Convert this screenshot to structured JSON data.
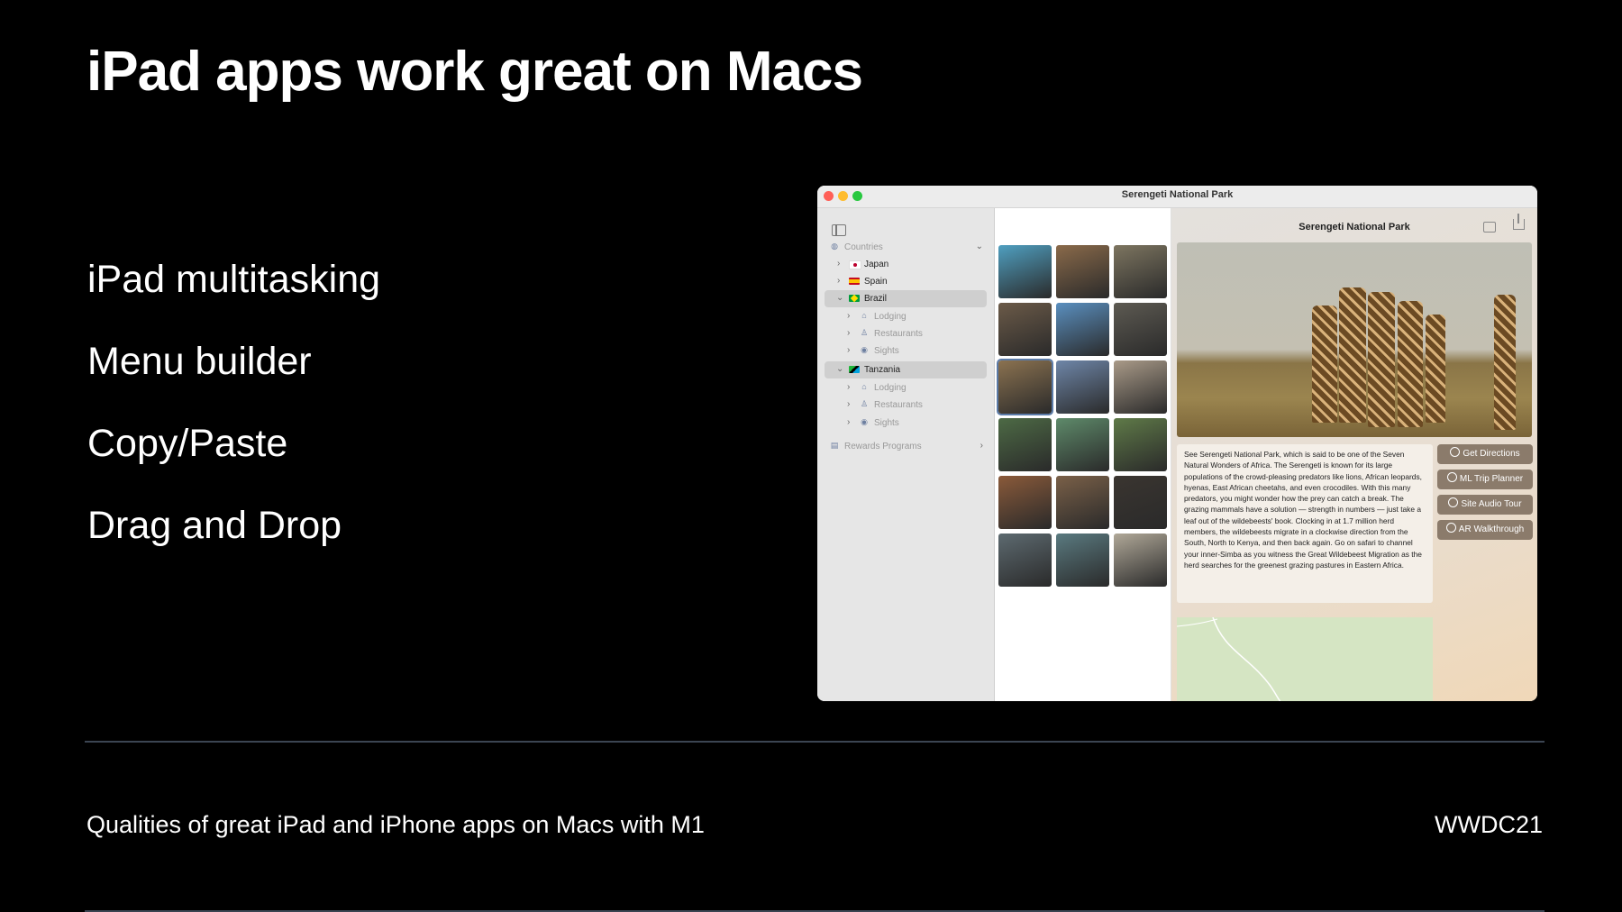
{
  "slide": {
    "title": "iPad apps work great on Macs",
    "bullets": [
      "iPad multitasking",
      "Menu builder",
      "Copy/Paste",
      "Drag and Drop"
    ],
    "footer_left": "Qualities of great iPad and iPhone apps on Macs with M1",
    "footer_right": "WWDC21"
  },
  "window": {
    "title": "Serengeti National Park",
    "sidebar": {
      "countries_label": "Countries",
      "items": [
        {
          "label": "Japan",
          "flag": "japan-flag",
          "expanded": false
        },
        {
          "label": "Spain",
          "flag": "spain-flag",
          "expanded": false
        },
        {
          "label": "Brazil",
          "flag": "brazil-flag",
          "expanded": true,
          "selected": true,
          "children": [
            "Lodging",
            "Restaurants",
            "Sights"
          ]
        },
        {
          "label": "Tanzania",
          "flag": "tanzania-flag",
          "expanded": true,
          "selected": true,
          "children": [
            "Lodging",
            "Restaurants",
            "Sights"
          ]
        }
      ],
      "rewards_label": "Rewards Programs"
    },
    "detail": {
      "title": "Serengeti National Park",
      "description": "See Serengeti National Park, which is said to be one of the Seven Natural Wonders of Africa. The Serengeti is known for its large populations of the crowd-pleasing predators like lions, African leopards, hyenas, East African cheetahs, and even crocodiles. With this many predators, you might wonder how the prey can catch a break. The grazing mammals have a solution — strength in numbers — just take a leaf out of the wildebeests' book. Clocking in at 1.7 million herd members, the wildebeests migrate in a clockwise direction from the South, North to Kenya, and then back again. Go on safari to channel your inner-Simba as you witness the Great Wildebeest Migration as the herd searches for the greenest grazing pastures in Eastern Africa.",
      "actions": [
        "Get Directions",
        "ML Trip Planner",
        "Site Audio Tour",
        "AR Walkthrough"
      ]
    }
  },
  "colors": {
    "background": "#000000",
    "divider": "#3b4552",
    "action_button": "#8b7b6b",
    "thumbnails": [
      "#4f9fc0",
      "#8a6a4a",
      "#7d7560",
      "#6b5a48",
      "#5a8fbf",
      "#5d5a52",
      "#8b7250",
      "#6e86a8",
      "#a99a88",
      "#4d6a45",
      "#5e8a6a",
      "#5f7a48",
      "#8a5a3a",
      "#7a6048",
      "#3a3530",
      "#5d6a70",
      "#5a7a80",
      "#b0a898"
    ]
  }
}
